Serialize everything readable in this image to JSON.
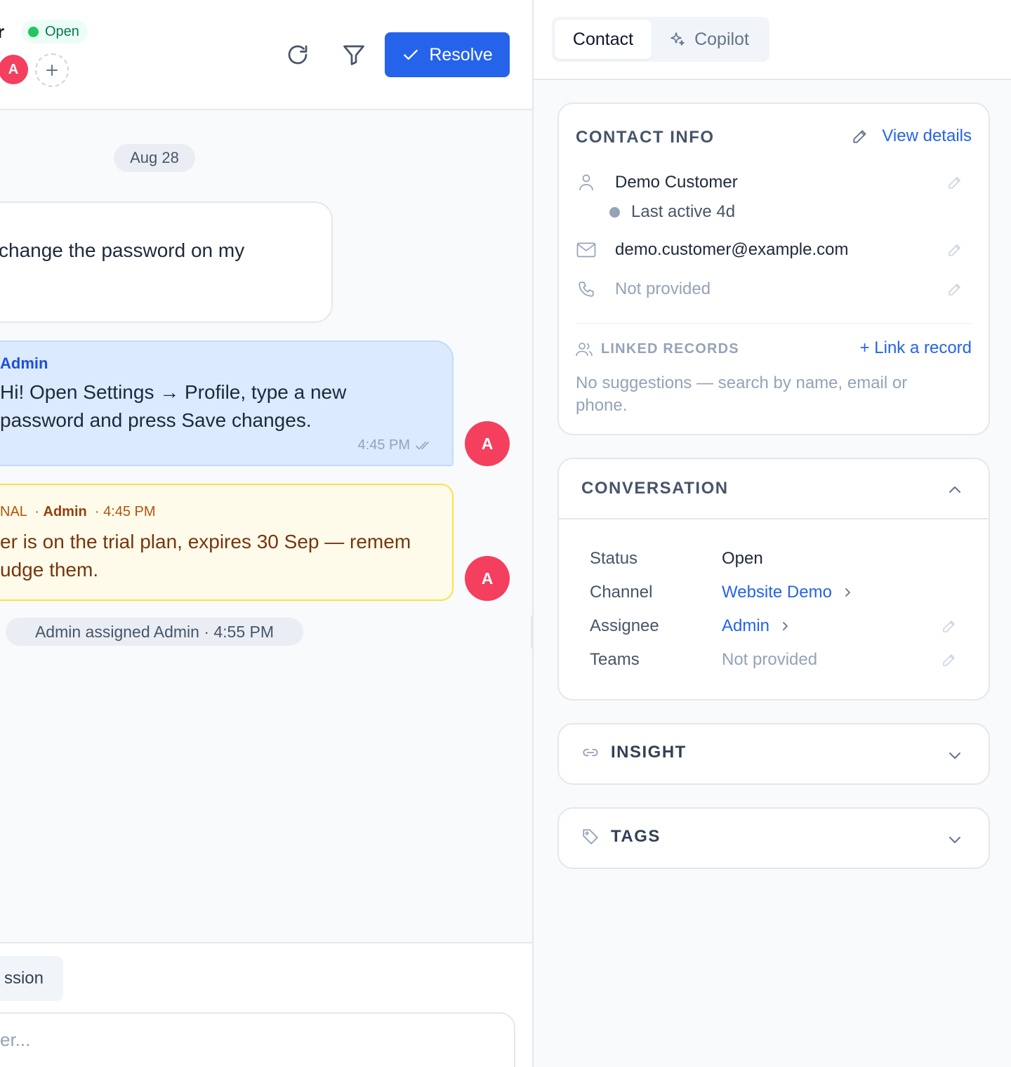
{
  "header": {
    "contact_name_fragment": "r",
    "status": "Open",
    "avatar_initial": "A",
    "resolve_label": "Resolve"
  },
  "thread": {
    "date_separator": "Aug 28",
    "incoming_message": "change the password on my",
    "outgoing": {
      "author": "Admin",
      "line1": "Hi! Open Settings → Profile, type a new",
      "line2": "password and press Save changes.",
      "time": "4:45 PM",
      "avatar_initial": "A"
    },
    "private_note": {
      "tag": "NAL",
      "author": "Admin",
      "time": "4:45 PM",
      "line1": "er is on the trial plan, expires 30 Sep — remem",
      "line2": "udge them.",
      "avatar_initial": "A"
    },
    "activity": "Admin assigned Admin · 4:55 PM"
  },
  "composer": {
    "tab_label": "ssion",
    "placeholder": "er..."
  },
  "sidebar": {
    "tabs": [
      {
        "label": "Contact",
        "active": true
      },
      {
        "label": "Copilot",
        "active": false
      }
    ],
    "contact_info": {
      "title": "CONTACT INFO",
      "view_details": "View details",
      "name": "Demo Customer",
      "last_active": "Last active 4d",
      "email": "demo.customer@example.com",
      "phone": "Not provided"
    },
    "linked_records": {
      "title": "LINKED RECORDS",
      "action": "+ Link a record",
      "empty_line1": "No suggestions — search by name, email or",
      "empty_line2": "phone."
    },
    "conversation": {
      "title": "CONVERSATION",
      "rows": [
        {
          "key": "Status",
          "value": "Open"
        },
        {
          "key": "Channel",
          "value": "Website Demo"
        },
        {
          "key": "Assignee",
          "value": "Admin"
        },
        {
          "key": "Teams",
          "value": "Not provided"
        }
      ]
    },
    "insight": {
      "title": "INSIGHT"
    },
    "tags": {
      "title": "TAGS"
    }
  },
  "colors": {
    "accent": "#2563eb",
    "avatar": "#f43f5e",
    "open_dot": "#22c55e",
    "note_border": "#fde047"
  }
}
